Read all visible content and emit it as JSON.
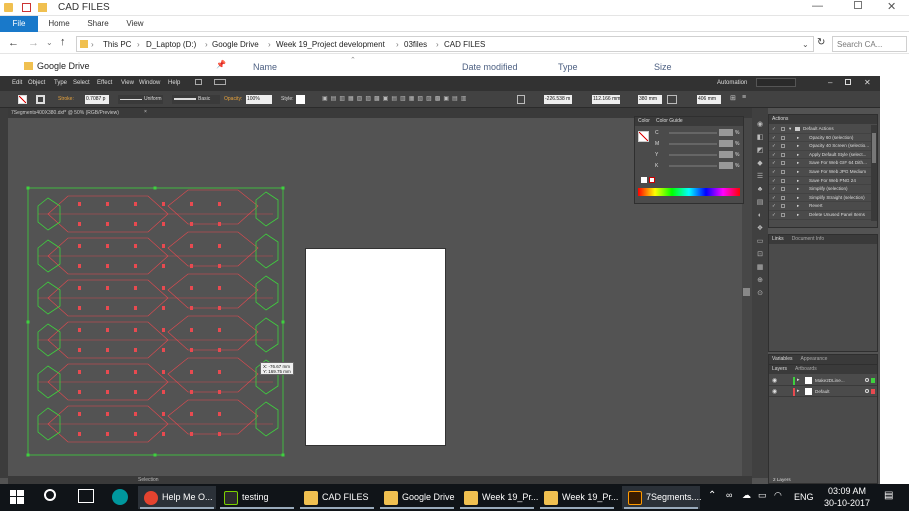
{
  "explorer": {
    "title": "CAD FILES",
    "tabs": [
      "File",
      "Home",
      "Share",
      "View"
    ],
    "breadcrumb": [
      "This PC",
      "D_Laptop (D:)",
      "Google Drive",
      "Week 19_Project development",
      "03files",
      "CAD FILES"
    ],
    "search_placeholder": "Search CA...",
    "nav_item": "Google Drive",
    "columns": [
      "Name",
      "Date modified",
      "Type",
      "Size"
    ]
  },
  "illustrator": {
    "menu": [
      "Edit",
      "Object",
      "Type",
      "Select",
      "Effect",
      "View",
      "Window",
      "Help"
    ],
    "workspace": "Automation",
    "control": {
      "stroke_label": "Stroke:",
      "stroke_value": "0.7087 p",
      "profile": "Uniform",
      "brush": "Basic",
      "opacity_label": "Opacity:",
      "opacity_value": "100%",
      "style_label": "Style:",
      "x_value": "-226.538 m",
      "y_value": "112.166 mm",
      "w_value": "380 mm",
      "h_value": "406 mm"
    },
    "doc_tab": "7Segments400X380.dxf* @ 50% (RGB/Preview)",
    "tooltip_x": "X: -76.67 mm",
    "tooltip_y": "Y: 169.75 mm",
    "status_tool": "Selection",
    "color_panel": {
      "tabs": [
        "Color",
        "Color Guide"
      ],
      "channels": [
        "C",
        "M",
        "Y",
        "K"
      ],
      "percent": "%"
    },
    "actions_panel": {
      "title": "Actions",
      "items": [
        "Default Actions",
        "Opacity 60 (selection)",
        "Opacity 40 Screen (selectio...",
        "Apply Default Style (select...",
        "Save For Web GIF 64 Dith...",
        "Save For Web JPG Medium",
        "Save For Web PNG 24",
        "Simplify (selection)",
        "Simplify Straight (selection)",
        "Revert",
        "Delete Unused Panel Items"
      ]
    },
    "links_panel": {
      "tabs": [
        "Links",
        "Document Info"
      ]
    },
    "variables_panel": {
      "tabs": [
        "Variables",
        "Appearance"
      ]
    },
    "layers_panel": {
      "tabs": [
        "Layers",
        "Artboards"
      ],
      "layers": [
        "Make2DLine...",
        "Default"
      ],
      "footer": "2 Layers"
    },
    "colors": {
      "bg": "#535353",
      "red": "#e84a50",
      "green": "#3ed13e"
    }
  },
  "taskbar": {
    "items": [
      {
        "label": "Help Me O...",
        "icon": "chrome-icon",
        "color": "#e4432f"
      },
      {
        "label": "testing",
        "icon": "muse-icon",
        "color": "#2b2b2b"
      },
      {
        "label": "CAD FILES",
        "icon": "folder-icon",
        "color": "#f0c050"
      },
      {
        "label": "Google Drive",
        "icon": "folder-icon",
        "color": "#f0c050"
      },
      {
        "label": "Week 19_Pr...",
        "icon": "folder-icon",
        "color": "#f0c050"
      },
      {
        "label": "Week 19_Pr...",
        "icon": "folder-icon",
        "color": "#f0c050"
      },
      {
        "label": "7Segments....",
        "icon": "illustrator-icon",
        "color": "#3a1c00"
      }
    ],
    "language": "ENG",
    "time": "03:09 AM",
    "date": "30-10-2017"
  }
}
